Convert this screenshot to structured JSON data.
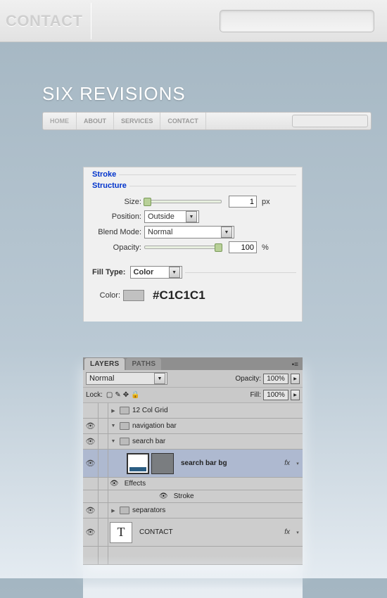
{
  "topnav": {
    "contact_label": "CONTACT",
    "search_value": ""
  },
  "preview": {
    "title": "SIX REVISIONS",
    "menu": [
      "HOME",
      "ABOUT",
      "SERVICES",
      "CONTACT"
    ],
    "search_value": ""
  },
  "stroke_panel": {
    "title": "Stroke",
    "structure_title": "Structure",
    "size_label": "Size:",
    "size_value": "1",
    "size_unit": "px",
    "position_label": "Position:",
    "position_value": "Outside",
    "blend_label": "Blend Mode:",
    "blend_value": "Normal",
    "opacity_label": "Opacity:",
    "opacity_value": "100",
    "opacity_unit": "%",
    "fill_type_label": "Fill Type:",
    "fill_type_value": "Color",
    "color_label": "Color:",
    "color_hex": "#C1C1C1"
  },
  "layers_panel": {
    "tabs": [
      "LAYERS",
      "PATHS"
    ],
    "blend_mode": "Normal",
    "opacity_label": "Opacity:",
    "opacity_value": "100%",
    "lock_label": "Lock:",
    "fill_label": "Fill:",
    "fill_value": "100%",
    "layers": [
      {
        "name": "12 Col Grid",
        "eye": false,
        "tri": "right",
        "depth": 0,
        "type": "folder"
      },
      {
        "name": "navigation bar",
        "eye": true,
        "tri": "down",
        "depth": 0,
        "type": "folder"
      },
      {
        "name": "search bar",
        "eye": true,
        "tri": "down",
        "depth": 1,
        "type": "folder"
      },
      {
        "name": "search bar bg",
        "eye": true,
        "depth": 2,
        "type": "layer-thumb",
        "fx": true
      },
      {
        "name": "Effects",
        "eye": true,
        "depth": 3,
        "type": "effects"
      },
      {
        "name": "Stroke",
        "eye": true,
        "depth": 4,
        "type": "effect-item"
      },
      {
        "name": "separators",
        "eye": true,
        "tri": "right",
        "depth": 1,
        "type": "folder"
      },
      {
        "name": "CONTACT",
        "eye": true,
        "depth": 1,
        "type": "text",
        "fx": true
      }
    ]
  }
}
